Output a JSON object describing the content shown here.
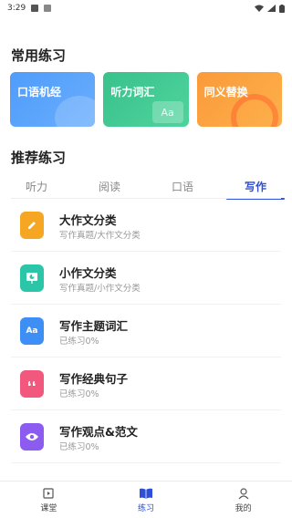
{
  "status": {
    "time": "3:29"
  },
  "common": {
    "title": "常用练习",
    "cards": [
      {
        "label": "口语机经",
        "color": "#4f9cfb"
      },
      {
        "label": "听力词汇",
        "color": "#39c28c",
        "deco_text": "Aa"
      },
      {
        "label": "同义替换",
        "color": "#fb9a3a"
      }
    ]
  },
  "recommend": {
    "title": "推荐练习",
    "tabs": [
      "听力",
      "阅读",
      "口语",
      "写作"
    ],
    "active_tab": "写作",
    "items": [
      {
        "title": "大作文分类",
        "subtitle": "写作真题/大作文分类",
        "icon": "pencil-icon",
        "color": "#f5a623"
      },
      {
        "title": "小作文分类",
        "subtitle": "写作真题/小作文分类",
        "icon": "pie-chart-icon",
        "color": "#2bc5a8"
      },
      {
        "title": "写作主题词汇",
        "subtitle": "已练习0%",
        "icon": "vocabulary-book-icon",
        "color": "#3d8ef5",
        "icon_text": "Aa"
      },
      {
        "title": "写作经典句子",
        "subtitle": "已练习0%",
        "icon": "quote-icon",
        "color": "#f2577e"
      },
      {
        "title": "写作观点&范文",
        "subtitle": "已练习0%",
        "icon": "eye-icon",
        "color": "#8c5cf0"
      }
    ]
  },
  "nav": {
    "items": [
      {
        "label": "课堂",
        "icon": "classroom-icon"
      },
      {
        "label": "练习",
        "icon": "book-icon"
      },
      {
        "label": "我的",
        "icon": "profile-icon"
      }
    ],
    "active": "练习",
    "accent": "#2e4fd6"
  }
}
